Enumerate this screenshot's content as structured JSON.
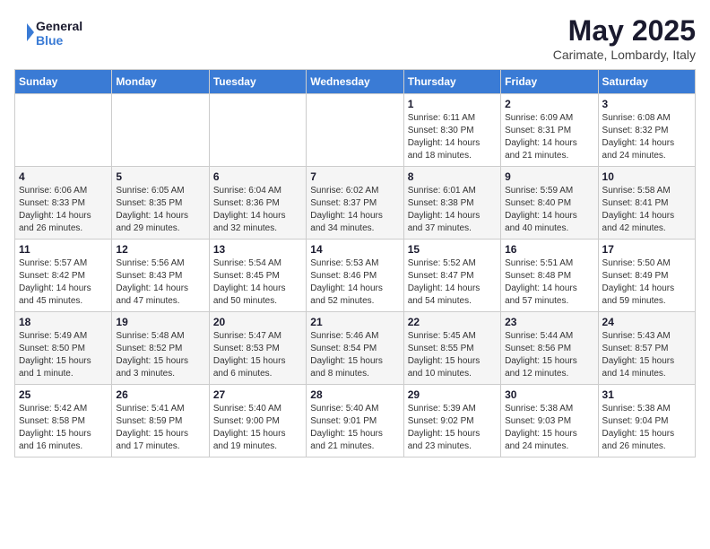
{
  "logo": {
    "line1": "General",
    "line2": "Blue"
  },
  "title": {
    "month_year": "May 2025",
    "location": "Carimate, Lombardy, Italy"
  },
  "days_of_week": [
    "Sunday",
    "Monday",
    "Tuesday",
    "Wednesday",
    "Thursday",
    "Friday",
    "Saturday"
  ],
  "weeks": [
    [
      {
        "day": "",
        "info": ""
      },
      {
        "day": "",
        "info": ""
      },
      {
        "day": "",
        "info": ""
      },
      {
        "day": "",
        "info": ""
      },
      {
        "day": "1",
        "info": "Sunrise: 6:11 AM\nSunset: 8:30 PM\nDaylight: 14 hours\nand 18 minutes."
      },
      {
        "day": "2",
        "info": "Sunrise: 6:09 AM\nSunset: 8:31 PM\nDaylight: 14 hours\nand 21 minutes."
      },
      {
        "day": "3",
        "info": "Sunrise: 6:08 AM\nSunset: 8:32 PM\nDaylight: 14 hours\nand 24 minutes."
      }
    ],
    [
      {
        "day": "4",
        "info": "Sunrise: 6:06 AM\nSunset: 8:33 PM\nDaylight: 14 hours\nand 26 minutes."
      },
      {
        "day": "5",
        "info": "Sunrise: 6:05 AM\nSunset: 8:35 PM\nDaylight: 14 hours\nand 29 minutes."
      },
      {
        "day": "6",
        "info": "Sunrise: 6:04 AM\nSunset: 8:36 PM\nDaylight: 14 hours\nand 32 minutes."
      },
      {
        "day": "7",
        "info": "Sunrise: 6:02 AM\nSunset: 8:37 PM\nDaylight: 14 hours\nand 34 minutes."
      },
      {
        "day": "8",
        "info": "Sunrise: 6:01 AM\nSunset: 8:38 PM\nDaylight: 14 hours\nand 37 minutes."
      },
      {
        "day": "9",
        "info": "Sunrise: 5:59 AM\nSunset: 8:40 PM\nDaylight: 14 hours\nand 40 minutes."
      },
      {
        "day": "10",
        "info": "Sunrise: 5:58 AM\nSunset: 8:41 PM\nDaylight: 14 hours\nand 42 minutes."
      }
    ],
    [
      {
        "day": "11",
        "info": "Sunrise: 5:57 AM\nSunset: 8:42 PM\nDaylight: 14 hours\nand 45 minutes."
      },
      {
        "day": "12",
        "info": "Sunrise: 5:56 AM\nSunset: 8:43 PM\nDaylight: 14 hours\nand 47 minutes."
      },
      {
        "day": "13",
        "info": "Sunrise: 5:54 AM\nSunset: 8:45 PM\nDaylight: 14 hours\nand 50 minutes."
      },
      {
        "day": "14",
        "info": "Sunrise: 5:53 AM\nSunset: 8:46 PM\nDaylight: 14 hours\nand 52 minutes."
      },
      {
        "day": "15",
        "info": "Sunrise: 5:52 AM\nSunset: 8:47 PM\nDaylight: 14 hours\nand 54 minutes."
      },
      {
        "day": "16",
        "info": "Sunrise: 5:51 AM\nSunset: 8:48 PM\nDaylight: 14 hours\nand 57 minutes."
      },
      {
        "day": "17",
        "info": "Sunrise: 5:50 AM\nSunset: 8:49 PM\nDaylight: 14 hours\nand 59 minutes."
      }
    ],
    [
      {
        "day": "18",
        "info": "Sunrise: 5:49 AM\nSunset: 8:50 PM\nDaylight: 15 hours\nand 1 minute."
      },
      {
        "day": "19",
        "info": "Sunrise: 5:48 AM\nSunset: 8:52 PM\nDaylight: 15 hours\nand 3 minutes."
      },
      {
        "day": "20",
        "info": "Sunrise: 5:47 AM\nSunset: 8:53 PM\nDaylight: 15 hours\nand 6 minutes."
      },
      {
        "day": "21",
        "info": "Sunrise: 5:46 AM\nSunset: 8:54 PM\nDaylight: 15 hours\nand 8 minutes."
      },
      {
        "day": "22",
        "info": "Sunrise: 5:45 AM\nSunset: 8:55 PM\nDaylight: 15 hours\nand 10 minutes."
      },
      {
        "day": "23",
        "info": "Sunrise: 5:44 AM\nSunset: 8:56 PM\nDaylight: 15 hours\nand 12 minutes."
      },
      {
        "day": "24",
        "info": "Sunrise: 5:43 AM\nSunset: 8:57 PM\nDaylight: 15 hours\nand 14 minutes."
      }
    ],
    [
      {
        "day": "25",
        "info": "Sunrise: 5:42 AM\nSunset: 8:58 PM\nDaylight: 15 hours\nand 16 minutes."
      },
      {
        "day": "26",
        "info": "Sunrise: 5:41 AM\nSunset: 8:59 PM\nDaylight: 15 hours\nand 17 minutes."
      },
      {
        "day": "27",
        "info": "Sunrise: 5:40 AM\nSunset: 9:00 PM\nDaylight: 15 hours\nand 19 minutes."
      },
      {
        "day": "28",
        "info": "Sunrise: 5:40 AM\nSunset: 9:01 PM\nDaylight: 15 hours\nand 21 minutes."
      },
      {
        "day": "29",
        "info": "Sunrise: 5:39 AM\nSunset: 9:02 PM\nDaylight: 15 hours\nand 23 minutes."
      },
      {
        "day": "30",
        "info": "Sunrise: 5:38 AM\nSunset: 9:03 PM\nDaylight: 15 hours\nand 24 minutes."
      },
      {
        "day": "31",
        "info": "Sunrise: 5:38 AM\nSunset: 9:04 PM\nDaylight: 15 hours\nand 26 minutes."
      }
    ]
  ]
}
